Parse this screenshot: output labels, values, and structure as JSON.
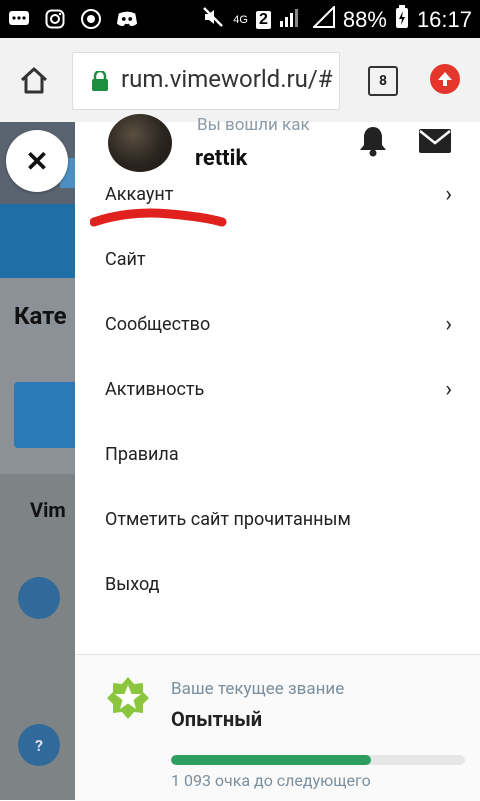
{
  "statusbar": {
    "network": "4G",
    "sim": "2",
    "battery": "88%",
    "time": "16:17"
  },
  "browser": {
    "url": "rum.vimeworld.ru/#",
    "tab_count": "8"
  },
  "background_page": {
    "title_partial": "Кате",
    "section_partial": "Vim",
    "help_icon_text": "?"
  },
  "drawer": {
    "logged_in_as": "Вы вошли как",
    "username": "rettik",
    "menu": [
      {
        "label": "Аккаунт",
        "has_chevron": true
      },
      {
        "label": "Сайт",
        "has_chevron": false
      },
      {
        "label": "Сообщество",
        "has_chevron": true
      },
      {
        "label": "Активность",
        "has_chevron": true
      },
      {
        "label": "Правила",
        "has_chevron": false
      },
      {
        "label": "Отметить сайт прочитанным",
        "has_chevron": false
      },
      {
        "label": "Выход",
        "has_chevron": false
      }
    ],
    "rank": {
      "label": "Ваше текущее звание",
      "name": "Опытный",
      "progress": 0.68,
      "points_text": "1 093 очка до следующего"
    }
  },
  "colors": {
    "accent_green": "#2e9e5e",
    "annotation_red": "#e0211d",
    "upload_red": "#e5362c",
    "lock_green": "#1e8e3e"
  },
  "close_symbol": "✕",
  "chevron_symbol": "›"
}
